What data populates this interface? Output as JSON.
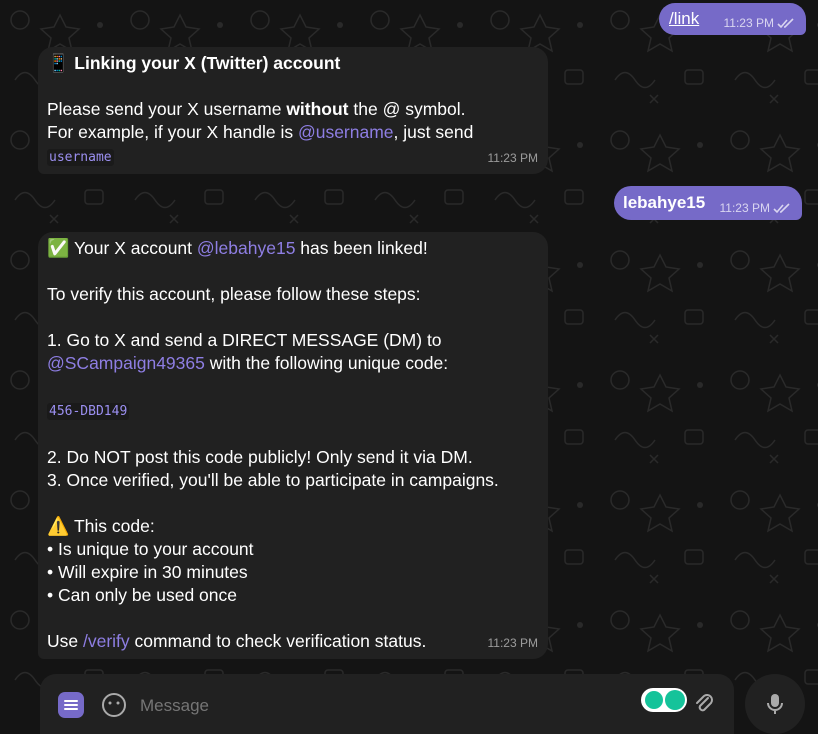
{
  "messages": {
    "out1": {
      "text": "/link",
      "time": "11:23 PM"
    },
    "in1": {
      "emoji": "📱",
      "title": "Linking your X (Twitter) account",
      "line1_a": "Please send your X username ",
      "line1_bold": "without",
      "line1_b": " the @ symbol.",
      "line2_a": "For example, if your X handle is ",
      "line2_link": "@username",
      "line2_b": ", just send",
      "code": "username",
      "time": "11:23 PM"
    },
    "out2": {
      "text": "lebahye15",
      "time": "11:23 PM"
    },
    "in2": {
      "emoji": "✅",
      "title_a": " Your X account ",
      "title_link": "@lebahye15",
      "title_b": " has been linked!",
      "intro": "To verify this account, please follow these steps:",
      "step1": "1. Go to X and send a DIRECT MESSAGE (DM) to",
      "step1_link": "@SCampaign49365",
      "step1_b": " with the following unique code:",
      "code": "456-DBD149",
      "step2": "2. Do NOT post this code publicly! Only send it via DM.",
      "step3": "3. Once verified, you'll be able to participate in campaigns.",
      "warn_emoji": "⚠️",
      "warn": " This code:",
      "bullets": [
        "• Is unique to your account",
        "• Will expire in 30 minutes",
        "• Can only be used once"
      ],
      "footer_a": "Use ",
      "footer_link": "/verify",
      "footer_b": " command to check verification status.",
      "time": "11:23 PM"
    }
  },
  "composer": {
    "placeholder": "Message"
  },
  "colors": {
    "accent": "#766ac8",
    "link": "#8e7ee3",
    "bubble_in": "#212121",
    "background": "#141414"
  }
}
